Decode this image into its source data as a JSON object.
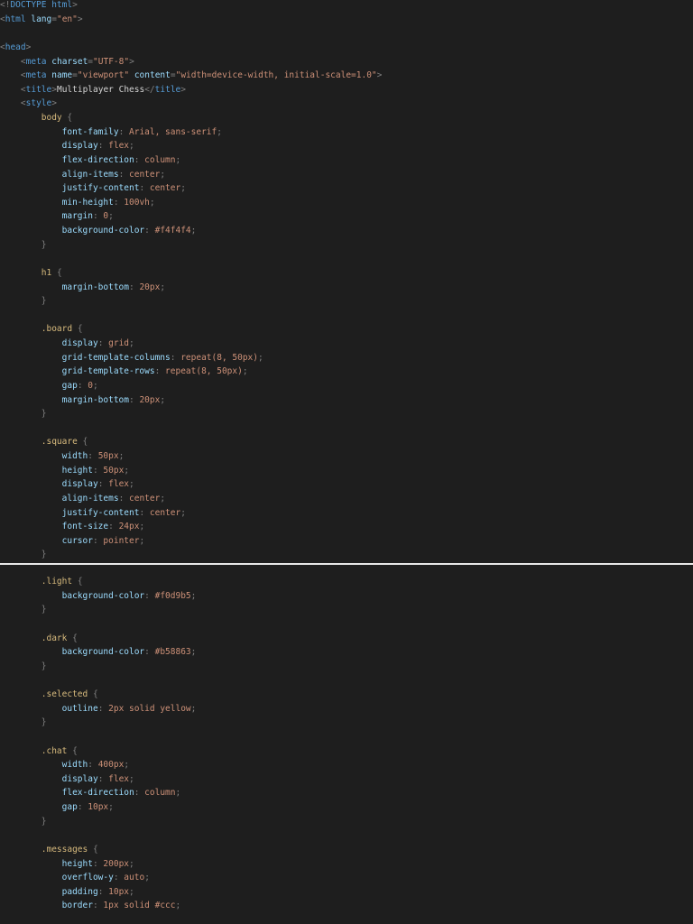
{
  "editor": {
    "theme": {
      "background": "#1e1e1e",
      "divider": "#e8e8e8",
      "text": "#d4d4d4",
      "punctuation": "#808080",
      "tag": "#569cd6",
      "attribute": "#9cdcfe",
      "string": "#ce9178",
      "selector": "#d7ba7d",
      "property": "#9cdcfe",
      "value": "#ce9178",
      "number": "#b5cea8"
    },
    "top_pane": {
      "lines": [
        [
          [
            "punct",
            "<!"
          ],
          [
            "tag",
            "DOCTYPE html"
          ],
          [
            "punct",
            ">"
          ]
        ],
        [
          [
            "punct",
            "<"
          ],
          [
            "tag",
            "html"
          ],
          [
            "text",
            " "
          ],
          [
            "attr",
            "lang"
          ],
          [
            "punct",
            "="
          ],
          [
            "str",
            "\"en\""
          ],
          [
            "punct",
            ">"
          ]
        ],
        [],
        [
          [
            "punct",
            "<"
          ],
          [
            "tag",
            "head"
          ],
          [
            "punct",
            ">"
          ]
        ],
        [
          [
            "text",
            "    "
          ],
          [
            "punct",
            "<"
          ],
          [
            "tag",
            "meta"
          ],
          [
            "text",
            " "
          ],
          [
            "attr",
            "charset"
          ],
          [
            "punct",
            "="
          ],
          [
            "str",
            "\"UTF-8\""
          ],
          [
            "punct",
            ">"
          ]
        ],
        [
          [
            "text",
            "    "
          ],
          [
            "punct",
            "<"
          ],
          [
            "tag",
            "meta"
          ],
          [
            "text",
            " "
          ],
          [
            "attr",
            "name"
          ],
          [
            "punct",
            "="
          ],
          [
            "str",
            "\"viewport\""
          ],
          [
            "text",
            " "
          ],
          [
            "attr",
            "content"
          ],
          [
            "punct",
            "="
          ],
          [
            "str",
            "\"width=device-width, initial-scale=1.0\""
          ],
          [
            "punct",
            ">"
          ]
        ],
        [
          [
            "text",
            "    "
          ],
          [
            "punct",
            "<"
          ],
          [
            "tag",
            "title"
          ],
          [
            "punct",
            ">"
          ],
          [
            "text",
            "Multiplayer Chess"
          ],
          [
            "punct",
            "</"
          ],
          [
            "tag",
            "title"
          ],
          [
            "punct",
            ">"
          ]
        ],
        [
          [
            "text",
            "    "
          ],
          [
            "punct",
            "<"
          ],
          [
            "tag",
            "style"
          ],
          [
            "punct",
            ">"
          ]
        ],
        [
          [
            "text",
            "        "
          ],
          [
            "sel",
            "body"
          ],
          [
            "text",
            " "
          ],
          [
            "punct",
            "{"
          ]
        ],
        [
          [
            "text",
            "            "
          ],
          [
            "prop",
            "font-family"
          ],
          [
            "punct",
            ": "
          ],
          [
            "val",
            "Arial, sans-serif"
          ],
          [
            "punct",
            ";"
          ]
        ],
        [
          [
            "text",
            "            "
          ],
          [
            "prop",
            "display"
          ],
          [
            "punct",
            ": "
          ],
          [
            "val",
            "flex"
          ],
          [
            "punct",
            ";"
          ]
        ],
        [
          [
            "text",
            "            "
          ],
          [
            "prop",
            "flex-direction"
          ],
          [
            "punct",
            ": "
          ],
          [
            "val",
            "column"
          ],
          [
            "punct",
            ";"
          ]
        ],
        [
          [
            "text",
            "            "
          ],
          [
            "prop",
            "align-items"
          ],
          [
            "punct",
            ": "
          ],
          [
            "val",
            "center"
          ],
          [
            "punct",
            ";"
          ]
        ],
        [
          [
            "text",
            "            "
          ],
          [
            "prop",
            "justify-content"
          ],
          [
            "punct",
            ": "
          ],
          [
            "val",
            "center"
          ],
          [
            "punct",
            ";"
          ]
        ],
        [
          [
            "text",
            "            "
          ],
          [
            "prop",
            "min-height"
          ],
          [
            "punct",
            ": "
          ],
          [
            "val",
            "100vh"
          ],
          [
            "punct",
            ";"
          ]
        ],
        [
          [
            "text",
            "            "
          ],
          [
            "prop",
            "margin"
          ],
          [
            "punct",
            ": "
          ],
          [
            "val",
            "0"
          ],
          [
            "punct",
            ";"
          ]
        ],
        [
          [
            "text",
            "            "
          ],
          [
            "prop",
            "background-color"
          ],
          [
            "punct",
            ": "
          ],
          [
            "val",
            "#f4f4f4"
          ],
          [
            "punct",
            ";"
          ]
        ],
        [
          [
            "text",
            "        "
          ],
          [
            "punct",
            "}"
          ]
        ],
        [],
        [
          [
            "text",
            "        "
          ],
          [
            "sel",
            "h1"
          ],
          [
            "text",
            " "
          ],
          [
            "punct",
            "{"
          ]
        ],
        [
          [
            "text",
            "            "
          ],
          [
            "prop",
            "margin-bottom"
          ],
          [
            "punct",
            ": "
          ],
          [
            "val",
            "20px"
          ],
          [
            "punct",
            ";"
          ]
        ],
        [
          [
            "text",
            "        "
          ],
          [
            "punct",
            "}"
          ]
        ],
        [],
        [
          [
            "text",
            "        "
          ],
          [
            "sel",
            ".board"
          ],
          [
            "text",
            " "
          ],
          [
            "punct",
            "{"
          ]
        ],
        [
          [
            "text",
            "            "
          ],
          [
            "prop",
            "display"
          ],
          [
            "punct",
            ": "
          ],
          [
            "val",
            "grid"
          ],
          [
            "punct",
            ";"
          ]
        ],
        [
          [
            "text",
            "            "
          ],
          [
            "prop",
            "grid-template-columns"
          ],
          [
            "punct",
            ": "
          ],
          [
            "val",
            "repeat(8, 50px)"
          ],
          [
            "punct",
            ";"
          ]
        ],
        [
          [
            "text",
            "            "
          ],
          [
            "prop",
            "grid-template-rows"
          ],
          [
            "punct",
            ": "
          ],
          [
            "val",
            "repeat(8, 50px)"
          ],
          [
            "punct",
            ";"
          ]
        ],
        [
          [
            "text",
            "            "
          ],
          [
            "prop",
            "gap"
          ],
          [
            "punct",
            ": "
          ],
          [
            "val",
            "0"
          ],
          [
            "punct",
            ";"
          ]
        ],
        [
          [
            "text",
            "            "
          ],
          [
            "prop",
            "margin-bottom"
          ],
          [
            "punct",
            ": "
          ],
          [
            "val",
            "20px"
          ],
          [
            "punct",
            ";"
          ]
        ],
        [
          [
            "text",
            "        "
          ],
          [
            "punct",
            "}"
          ]
        ],
        [],
        [
          [
            "text",
            "        "
          ],
          [
            "sel",
            ".square"
          ],
          [
            "text",
            " "
          ],
          [
            "punct",
            "{"
          ]
        ],
        [
          [
            "text",
            "            "
          ],
          [
            "prop",
            "width"
          ],
          [
            "punct",
            ": "
          ],
          [
            "val",
            "50px"
          ],
          [
            "punct",
            ";"
          ]
        ],
        [
          [
            "text",
            "            "
          ],
          [
            "prop",
            "height"
          ],
          [
            "punct",
            ": "
          ],
          [
            "val",
            "50px"
          ],
          [
            "punct",
            ";"
          ]
        ],
        [
          [
            "text",
            "            "
          ],
          [
            "prop",
            "display"
          ],
          [
            "punct",
            ": "
          ],
          [
            "val",
            "flex"
          ],
          [
            "punct",
            ";"
          ]
        ],
        [
          [
            "text",
            "            "
          ],
          [
            "prop",
            "align-items"
          ],
          [
            "punct",
            ": "
          ],
          [
            "val",
            "center"
          ],
          [
            "punct",
            ";"
          ]
        ],
        [
          [
            "text",
            "            "
          ],
          [
            "prop",
            "justify-content"
          ],
          [
            "punct",
            ": "
          ],
          [
            "val",
            "center"
          ],
          [
            "punct",
            ";"
          ]
        ],
        [
          [
            "text",
            "            "
          ],
          [
            "prop",
            "font-size"
          ],
          [
            "punct",
            ": "
          ],
          [
            "val",
            "24px"
          ],
          [
            "punct",
            ";"
          ]
        ],
        [
          [
            "text",
            "            "
          ],
          [
            "prop",
            "cursor"
          ],
          [
            "punct",
            ": "
          ],
          [
            "val",
            "pointer"
          ],
          [
            "punct",
            ";"
          ]
        ],
        [
          [
            "text",
            "        "
          ],
          [
            "punct",
            "}"
          ]
        ]
      ]
    },
    "bottom_pane": {
      "lines": [
        [
          [
            "text",
            "        "
          ],
          [
            "sel",
            ".light"
          ],
          [
            "text",
            " "
          ],
          [
            "punct",
            "{"
          ]
        ],
        [
          [
            "text",
            "            "
          ],
          [
            "prop",
            "background-color"
          ],
          [
            "punct",
            ": "
          ],
          [
            "val",
            "#f0d9b5"
          ],
          [
            "punct",
            ";"
          ]
        ],
        [
          [
            "text",
            "        "
          ],
          [
            "punct",
            "}"
          ]
        ],
        [],
        [
          [
            "text",
            "        "
          ],
          [
            "sel",
            ".dark"
          ],
          [
            "text",
            " "
          ],
          [
            "punct",
            "{"
          ]
        ],
        [
          [
            "text",
            "            "
          ],
          [
            "prop",
            "background-color"
          ],
          [
            "punct",
            ": "
          ],
          [
            "val",
            "#b58863"
          ],
          [
            "punct",
            ";"
          ]
        ],
        [
          [
            "text",
            "        "
          ],
          [
            "punct",
            "}"
          ]
        ],
        [],
        [
          [
            "text",
            "        "
          ],
          [
            "sel",
            ".selected"
          ],
          [
            "text",
            " "
          ],
          [
            "punct",
            "{"
          ]
        ],
        [
          [
            "text",
            "            "
          ],
          [
            "prop",
            "outline"
          ],
          [
            "punct",
            ": "
          ],
          [
            "val",
            "2px solid yellow"
          ],
          [
            "punct",
            ";"
          ]
        ],
        [
          [
            "text",
            "        "
          ],
          [
            "punct",
            "}"
          ]
        ],
        [],
        [
          [
            "text",
            "        "
          ],
          [
            "sel",
            ".chat"
          ],
          [
            "text",
            " "
          ],
          [
            "punct",
            "{"
          ]
        ],
        [
          [
            "text",
            "            "
          ],
          [
            "prop",
            "width"
          ],
          [
            "punct",
            ": "
          ],
          [
            "val",
            "400px"
          ],
          [
            "punct",
            ";"
          ]
        ],
        [
          [
            "text",
            "            "
          ],
          [
            "prop",
            "display"
          ],
          [
            "punct",
            ": "
          ],
          [
            "val",
            "flex"
          ],
          [
            "punct",
            ";"
          ]
        ],
        [
          [
            "text",
            "            "
          ],
          [
            "prop",
            "flex-direction"
          ],
          [
            "punct",
            ": "
          ],
          [
            "val",
            "column"
          ],
          [
            "punct",
            ";"
          ]
        ],
        [
          [
            "text",
            "            "
          ],
          [
            "prop",
            "gap"
          ],
          [
            "punct",
            ": "
          ],
          [
            "val",
            "10px"
          ],
          [
            "punct",
            ";"
          ]
        ],
        [
          [
            "text",
            "        "
          ],
          [
            "punct",
            "}"
          ]
        ],
        [],
        [
          [
            "text",
            "        "
          ],
          [
            "sel",
            ".messages"
          ],
          [
            "text",
            " "
          ],
          [
            "punct",
            "{"
          ]
        ],
        [
          [
            "text",
            "            "
          ],
          [
            "prop",
            "height"
          ],
          [
            "punct",
            ": "
          ],
          [
            "val",
            "200px"
          ],
          [
            "punct",
            ";"
          ]
        ],
        [
          [
            "text",
            "            "
          ],
          [
            "prop",
            "overflow-y"
          ],
          [
            "punct",
            ": "
          ],
          [
            "val",
            "auto"
          ],
          [
            "punct",
            ";"
          ]
        ],
        [
          [
            "text",
            "            "
          ],
          [
            "prop",
            "padding"
          ],
          [
            "punct",
            ": "
          ],
          [
            "val",
            "10px"
          ],
          [
            "punct",
            ";"
          ]
        ],
        [
          [
            "text",
            "            "
          ],
          [
            "prop",
            "border"
          ],
          [
            "punct",
            ": "
          ],
          [
            "val",
            "1px solid #ccc"
          ],
          [
            "punct",
            ";"
          ]
        ]
      ]
    }
  }
}
